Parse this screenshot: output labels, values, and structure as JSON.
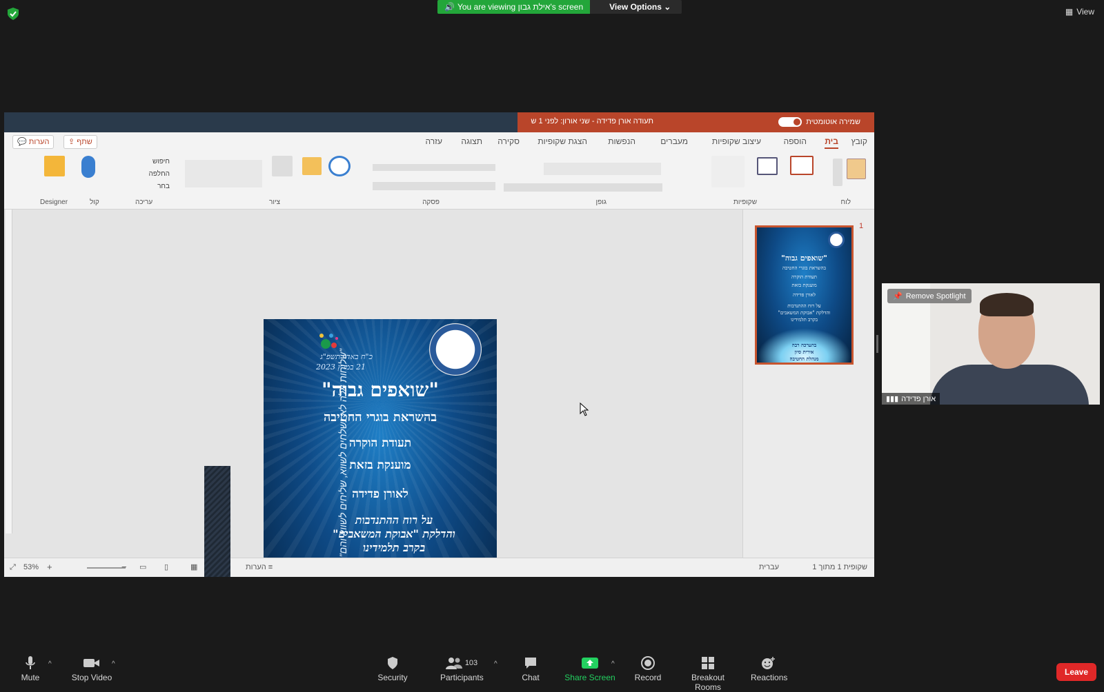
{
  "top": {
    "banner_text": "You are viewing אילת גבון's screen",
    "view_options_label": "View Options",
    "view_label": "View"
  },
  "ppt": {
    "title": "תעודה אורן פדידה - שני אורון: לפני 1 ש",
    "autosave_label": "שמירה אוטומטית",
    "tabs": [
      "קובץ",
      "בית",
      "הוספה",
      "עיצוב שקופיות",
      "מעברים",
      "הנפשות",
      "הצגת שקופיות",
      "סקירה",
      "תצוגה",
      "עזרה"
    ],
    "share_label": "שתף",
    "comments_label": "הערות",
    "groups": [
      "לוח",
      "שקופיות",
      "גופן",
      "פסקה",
      "ציור",
      "עריכה",
      "קול",
      "Designer"
    ],
    "edit_items": [
      "חיפוש",
      "החלפה",
      "בחר"
    ],
    "status_slide": "שקופית 1 מתוך 1",
    "status_lang": "עברית",
    "status_notes": "הערות",
    "zoom": "53%",
    "thumb_number": "1"
  },
  "slide": {
    "date_line1": "כ\"ח באדר תשפ\"ג",
    "date_line2": "21 במרץ 2023",
    "title": "\"שואפים גבוה\"",
    "subtitle": "בהשראת בוגרי החטיבה",
    "cert": "תעודת הוקרה",
    "awarded": "מוענקת בזאת",
    "recipient": "לאורן פדידה",
    "reason1": "על רוח ההתנדבות",
    "reason2": "והדלקת \"אבוקת המשאבים\"",
    "reason3": "בקרב תלמידינו",
    "sign1": "בהערכה רבה",
    "sign2": "אירית סיון",
    "sign3": "מנהלת החטיבה",
    "vertical": "\"שלוחות אלה לא נשלחים לשווא, שליחים לשווא והם\" - הרב יהודה"
  },
  "participant": {
    "spotlight_label": "Remove Spotlight",
    "name": "אורן פדידה"
  },
  "toolbar": {
    "mute": "Mute",
    "stop_video": "Stop Video",
    "security": "Security",
    "participants": "Participants",
    "participants_count": "103",
    "chat": "Chat",
    "share_screen": "Share Screen",
    "record": "Record",
    "breakout": "Breakout Rooms",
    "reactions": "Reactions",
    "leave": "Leave"
  },
  "colors": {
    "zoom_green": "#23a63a",
    "ppt_orange": "#b9452a",
    "leave_red": "#e02828"
  }
}
